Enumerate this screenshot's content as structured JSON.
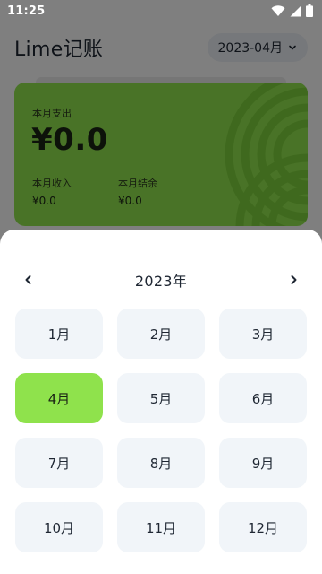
{
  "status_bar": {
    "time": "11:25",
    "icons": [
      "wifi-icon",
      "signal-icon",
      "battery-icon"
    ]
  },
  "header": {
    "title": "Lime记账",
    "month_picker_label": "2023-04月",
    "month_picker_icon": "chevron-down-icon"
  },
  "summary_card": {
    "expense_label": "本月支出",
    "expense_amount": "¥0.0",
    "income_label": "本月收入",
    "income_amount": "¥0.0",
    "balance_label": "本月结余",
    "balance_amount": "¥0.0",
    "color": "#93e74f"
  },
  "month_sheet": {
    "year_label": "2023年",
    "prev_icon": "chevron-left-icon",
    "next_icon": "chevron-right-icon",
    "months": [
      "1月",
      "2月",
      "3月",
      "4月",
      "5月",
      "6月",
      "7月",
      "8月",
      "9月",
      "10月",
      "11月",
      "12月"
    ],
    "selected_index": 3,
    "selected_color": "#8fe24c",
    "cell_color": "#f1f5f9"
  }
}
